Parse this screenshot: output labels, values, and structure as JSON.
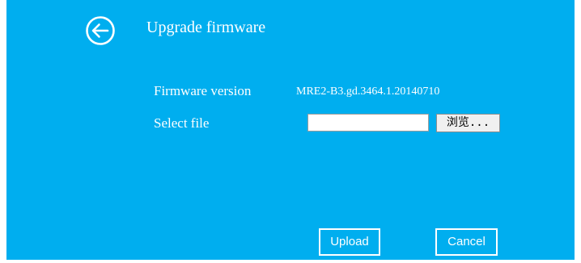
{
  "header": {
    "back_icon": "arrow-left-circle-icon",
    "title": "Upgrade firmware"
  },
  "form": {
    "firmware_version_label": "Firmware version",
    "firmware_version_value": "MRE2-B3.gd.3464.1.20140710",
    "select_file_label": "Select file",
    "file_input_value": "",
    "browse_button_label": "浏览..."
  },
  "actions": {
    "upload_label": "Upload",
    "cancel_label": "Cancel"
  },
  "colors": {
    "background": "#00aeef",
    "foreground": "#ffffff"
  }
}
